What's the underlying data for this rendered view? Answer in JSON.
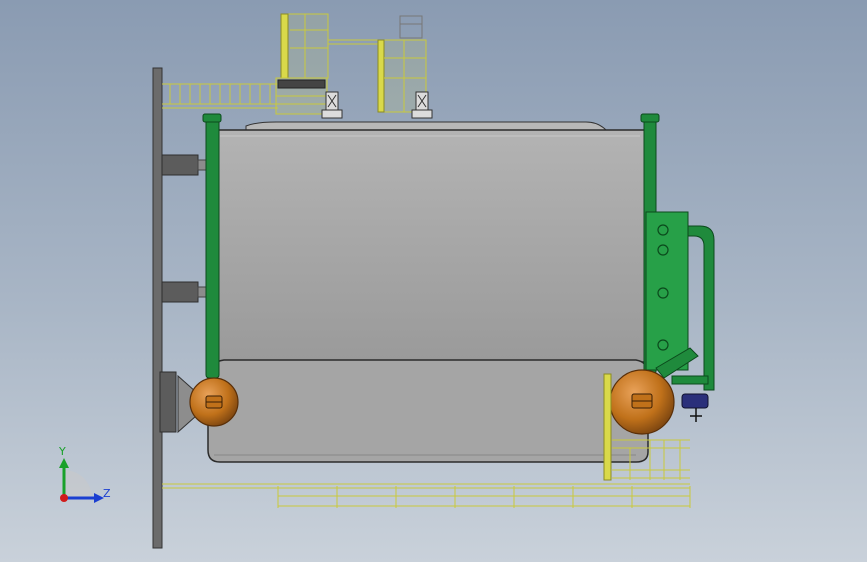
{
  "viewport": {
    "view": "Left",
    "background_top": "#8a9bb2",
    "background_bottom": "#c9d1da"
  },
  "model": {
    "shell_color": "#a3a3a3",
    "frame_color": "#6b6b6b",
    "pipe_color": "#1f8a3c",
    "drum_color": "#c0711a",
    "railing_color": "#d9d94a"
  },
  "triad": {
    "y_label": "Y",
    "z_label": "Z",
    "y_color": "#19a12a",
    "z_color": "#1b3fd1",
    "x_color": "#d01b1b"
  }
}
